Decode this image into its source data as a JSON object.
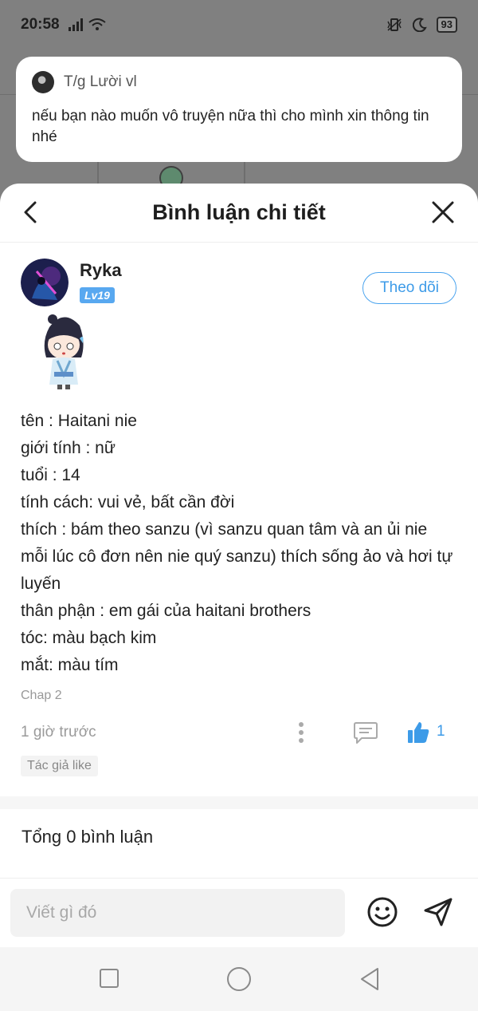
{
  "status_bar": {
    "time": "20:58",
    "battery": "93"
  },
  "notification": {
    "sender": "T/g Lười vl",
    "message": "nếu bạn nào muốn vô truyện nữa thì cho mình xin thông tin nhé"
  },
  "sheet": {
    "title": "Bình luận chi tiết",
    "back_icon": "chevron-left-icon",
    "close_icon": "close-icon"
  },
  "comment": {
    "author": "Ryka",
    "level": "Lv19",
    "follow_label": "Theo dõi",
    "lines": [
      "tên : Haitani nie",
      "giới tính : nữ",
      "tuổi : 14",
      "tính cách: vui vẻ, bất cần đời",
      "thích : bám theo sanzu (vì sanzu quan tâm và an ủi nie mỗi lúc cô đơn nên nie quý sanzu) thích sống ảo và hơi tự luyến",
      "thân phận : em gái của haitani brothers",
      "tóc: màu bạch kim",
      "mắt: màu tím"
    ],
    "chapter": "Chap 2",
    "time": "1 giờ trước",
    "like_count": "1",
    "author_like_badge": "Tác giả like"
  },
  "total_comments": "Tổng 0 bình luận",
  "input": {
    "placeholder": "Viết gì đó"
  },
  "colors": {
    "accent": "#3d9be8",
    "level_badge": "#58a8f0",
    "background_dim": "#808080"
  }
}
